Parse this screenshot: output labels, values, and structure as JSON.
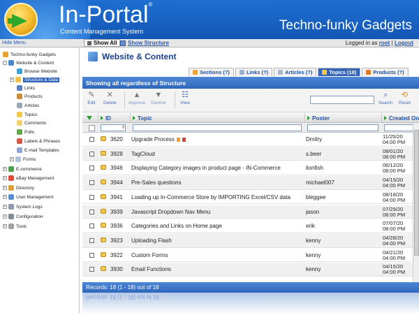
{
  "header": {
    "brand": "In-Portal",
    "tagline": "Content Management System",
    "site_name": "Techno-funky Gadgets"
  },
  "topbar": {
    "hide_menu": "Hide Menu",
    "show_all": "Show All",
    "show_structure": "Show Structure",
    "logged_prefix": "Logged in as",
    "user": "root",
    "sep": "|",
    "logout": "Logout"
  },
  "sidebar": {
    "items": [
      {
        "label": "Techno-funky Gadgets",
        "icon": "home-icon"
      },
      {
        "label": "Website & Content",
        "icon": "folder-icon"
      },
      {
        "label": "Browse Website",
        "icon": "globe-icon"
      },
      {
        "label": "Structure & Data",
        "icon": "folder-open-icon"
      },
      {
        "label": "Links",
        "icon": "link-icon"
      },
      {
        "label": "Products",
        "icon": "box-icon"
      },
      {
        "label": "Articles",
        "icon": "article-icon"
      },
      {
        "label": "Topics",
        "icon": "topic-icon"
      },
      {
        "label": "Comments",
        "icon": "comment-icon"
      },
      {
        "label": "Polls",
        "icon": "poll-icon"
      },
      {
        "label": "Labels & Phrases",
        "icon": "label-icon"
      },
      {
        "label": "E-mail Templates",
        "icon": "email-icon"
      },
      {
        "label": "Forms",
        "icon": "form-icon"
      },
      {
        "label": "E-commerce",
        "icon": "cart-icon"
      },
      {
        "label": "eBay Management",
        "icon": "ebay-icon"
      },
      {
        "label": "Directory",
        "icon": "directory-icon"
      },
      {
        "label": "User Management",
        "icon": "users-icon"
      },
      {
        "label": "System Logs",
        "icon": "log-icon"
      },
      {
        "label": "Configuration",
        "icon": "config-icon"
      },
      {
        "label": "Tools",
        "icon": "tools-icon"
      }
    ]
  },
  "page": {
    "title": "Website & Content"
  },
  "tabs": [
    {
      "label": "Sections (?)"
    },
    {
      "label": "Links (?)"
    },
    {
      "label": "Articles (?)"
    },
    {
      "label": "Topics (18)"
    },
    {
      "label": "Products (?)"
    }
  ],
  "panel": {
    "title": "Showing all regardless of Structure"
  },
  "toolbar": {
    "edit": "Edit",
    "delete": "Delete",
    "approve": "Approve",
    "decline": "Decline",
    "view": "View",
    "search": "Search",
    "reset": "Reset"
  },
  "grid": {
    "columns": {
      "id": "ID",
      "topic": "Topic",
      "poster": "Poster",
      "created": "Created On"
    },
    "rows": [
      {
        "id": "3620",
        "topic": "Upgrade Process",
        "poster": "Dmitry",
        "date": "11/25/20",
        "time": "04:00 PM"
      },
      {
        "id": "3928",
        "topic": "TagCloud",
        "poster": "s.beer",
        "date": "08/01/20",
        "time": "08:00 PM"
      },
      {
        "id": "3946",
        "topic": "Displaying Category images in product page - IN-Commerce",
        "poster": "lionfish",
        "date": "06/12/20",
        "time": "08:00 PM"
      },
      {
        "id": "3944",
        "topic": "Pre-Sales questions",
        "poster": "michael007",
        "date": "04/15/20",
        "time": "04:00 PM"
      },
      {
        "id": "3941",
        "topic": "Loading up In-Commerce Store by IMPORTING Excel/CSV data",
        "poster": "bleggee",
        "date": "08/18/20",
        "time": "04:00 PM"
      },
      {
        "id": "3939",
        "topic": "Javascript Dropdown Nav Menu",
        "poster": "jason",
        "date": "07/29/20",
        "time": "08:00 PM"
      },
      {
        "id": "3936",
        "topic": "Categories and Links on Home page",
        "poster": "erik",
        "date": "07/07/20",
        "time": "08:00 PM"
      },
      {
        "id": "3923",
        "topic": "Uploading Flash",
        "poster": "kenny",
        "date": "04/28/20",
        "time": "04:00 PM"
      },
      {
        "id": "3922",
        "topic": "Custom Forms",
        "poster": "kenny",
        "date": "04/21/20",
        "time": "04:00 PM"
      },
      {
        "id": "3930",
        "topic": "Email Functions",
        "poster": "kenny",
        "date": "04/15/20",
        "time": "04:00 PM"
      }
    ]
  },
  "footer": {
    "records": "Records: 18 (1 - 18) out of 18"
  },
  "colors": {
    "header_blue": "#1357b4",
    "panel_blue": "#2e66bb",
    "link_blue": "#2a57a8"
  }
}
